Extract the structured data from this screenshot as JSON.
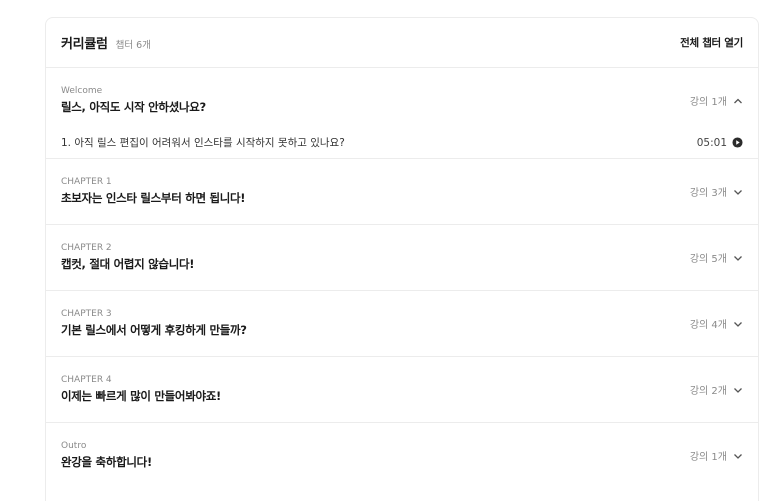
{
  "header": {
    "title": "커리큘럼",
    "count": "챕터 6개",
    "open_all": "전체 챕터 열기"
  },
  "chapters": [
    {
      "label": "Welcome",
      "title": "릴스, 아직도 시작 안하셨나요?",
      "lectures": "강의 1개",
      "expanded": true,
      "lessons": [
        {
          "title": "1. 아직 릴스 편집이 어려워서 인스타를 시작하지 못하고 있나요?",
          "duration": "05:01"
        }
      ]
    },
    {
      "label": "CHAPTER 1",
      "title": "초보자는 인스타 릴스부터 하면 됩니다!",
      "lectures": "강의 3개",
      "expanded": false
    },
    {
      "label": "CHAPTER 2",
      "title": "캡컷, 절대 어렵지 않습니다!",
      "lectures": "강의 5개",
      "expanded": false
    },
    {
      "label": "CHAPTER 3",
      "title": "기본 릴스에서 어떻게 후킹하게 만들까?",
      "lectures": "강의 4개",
      "expanded": false
    },
    {
      "label": "CHAPTER 4",
      "title": "이제는 빠르게 많이 만들어봐야죠!",
      "lectures": "강의 2개",
      "expanded": false
    },
    {
      "label": "Outro",
      "title": "완강을 축하합니다!",
      "lectures": "강의 1개",
      "expanded": false
    }
  ],
  "icons": {
    "expanded": "chevron-up-icon",
    "collapsed": "chevron-down-icon",
    "play": "play-circle-icon"
  }
}
